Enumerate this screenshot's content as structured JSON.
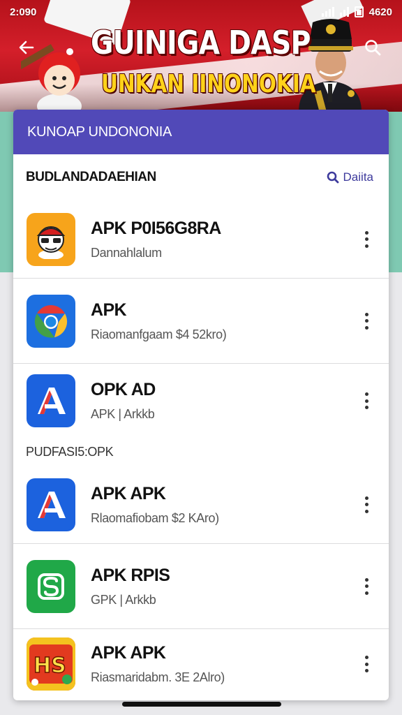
{
  "status": {
    "time": "2:090",
    "right_text": "4620"
  },
  "banner": {
    "title": "GUINIGA DASP",
    "subtitle": "UNKAN IINONOKIA"
  },
  "card": {
    "header_title": "KUNOAP UNDONONIA",
    "section_title": "BUDLANDADAEHIAN",
    "section_link": "Daiita",
    "section2_title": "PUDFASI5:OPK",
    "items": [
      {
        "name": "APK P0I56G8RA",
        "subtitle": "Dannahlalum",
        "icon": "mascot-app-icon",
        "icon_color": "#f7a41b"
      },
      {
        "name": "APK",
        "subtitle": "Riaomanfgaam $4 52kro)",
        "icon": "chrome-app-icon",
        "icon_color": "#1d6fe0"
      },
      {
        "name": "OPK AD",
        "subtitle": "APK | Arkkb",
        "icon": "letter-a-app-icon",
        "icon_color": "#1c62de"
      },
      {
        "name": "APK APK",
        "subtitle": "Rlaomafiobam $2 KAro)",
        "icon": "letter-a-app-icon",
        "icon_color": "#1c62de"
      },
      {
        "name": "APK RPIS",
        "subtitle": "GPK | Arkkb",
        "icon": "green-s-app-icon",
        "icon_color": "#20a848"
      },
      {
        "name": "APK APK",
        "subtitle": "Riasmaridabm. 3E 2Alro)",
        "icon": "game-app-icon",
        "icon_color": "#e23a1f"
      }
    ]
  }
}
